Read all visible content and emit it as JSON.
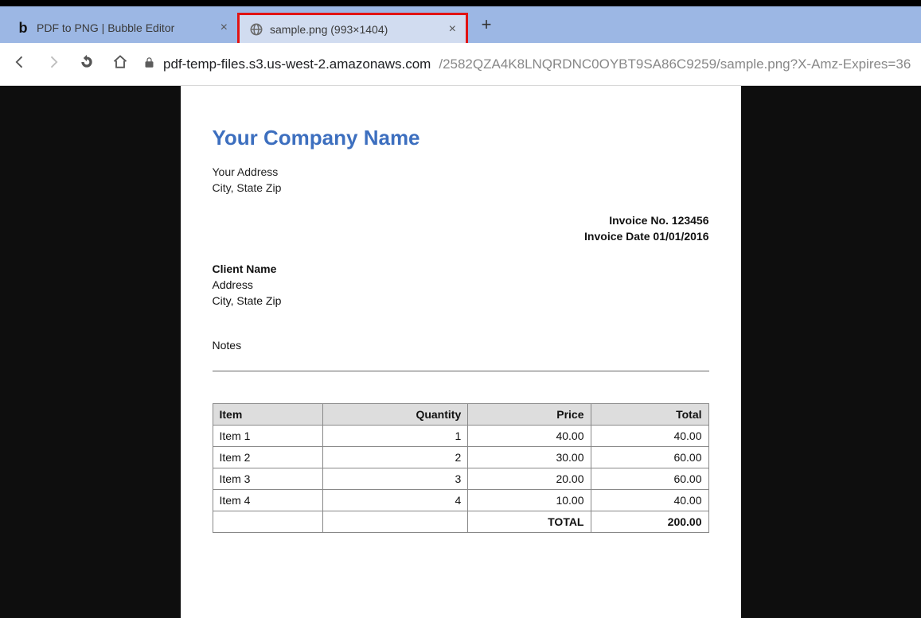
{
  "browser": {
    "tabs": [
      {
        "title": "PDF to PNG | Bubble Editor",
        "favicon": "bubble",
        "active": false
      },
      {
        "title": "sample.png (993×1404)",
        "favicon": "globe",
        "active": true
      }
    ],
    "url_host": "pdf-temp-files.s3.us-west-2.amazonaws.com",
    "url_path": "/2582QZA4K8LNQRDNC0OYBT9SA86C9259/sample.png?X-Amz-Expires=36…"
  },
  "invoice": {
    "company_name": "Your Company Name",
    "company_address_line1": "Your Address",
    "company_address_line2": "City, State Zip",
    "invoice_no_label": "Invoice No. ",
    "invoice_no": "123456",
    "invoice_date_label": "Invoice Date ",
    "invoice_date": "01/01/2016",
    "client_name": "Client Name",
    "client_address_line1": "Address",
    "client_address_line2": "City, State Zip",
    "notes_label": "Notes",
    "headers": {
      "item": "Item",
      "qty": "Quantity",
      "price": "Price",
      "total": "Total"
    },
    "rows": [
      {
        "item": "Item 1",
        "qty": "1",
        "price": "40.00",
        "total": "40.00"
      },
      {
        "item": "Item 2",
        "qty": "2",
        "price": "30.00",
        "total": "60.00"
      },
      {
        "item": "Item 3",
        "qty": "3",
        "price": "20.00",
        "total": "60.00"
      },
      {
        "item": "Item 4",
        "qty": "4",
        "price": "10.00",
        "total": "40.00"
      }
    ],
    "total_label": "TOTAL",
    "total_value": "200.00"
  }
}
